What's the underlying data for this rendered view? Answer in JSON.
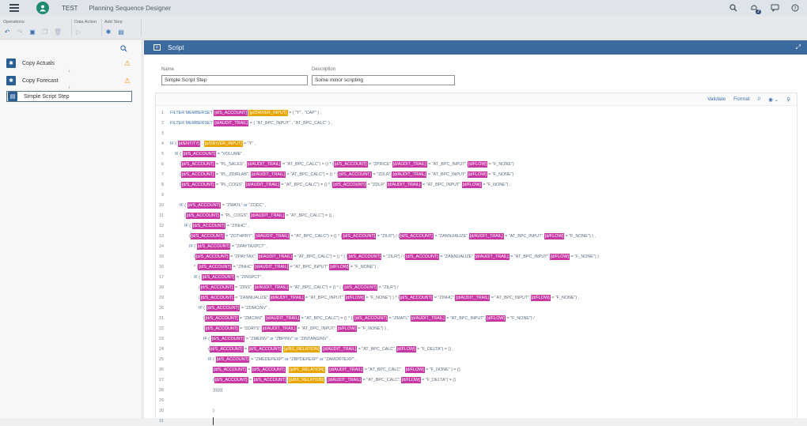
{
  "shell": {
    "app_name": "TEST",
    "title": "Planning Sequence Designer"
  },
  "toolbar": {
    "groups": [
      {
        "label": "Operations"
      },
      {
        "label": "Data Action"
      },
      {
        "label": "Add Step"
      }
    ]
  },
  "steps": [
    {
      "label": "Copy Actuals",
      "warning": true
    },
    {
      "label": "Copy Forecast",
      "warning": true
    },
    {
      "label": "Simple Script Step",
      "warning": false
    }
  ],
  "panel": {
    "title": "Script",
    "name_label": "Name",
    "name_value": "Simple Script Step",
    "desc_label": "Description",
    "desc_value": "Some minor scripting"
  },
  "code_toolbar": {
    "validate": "Validate",
    "format": "Format"
  },
  "code": {
    "line_numbers": [
      "1",
      "2",
      "3",
      "4",
      "5",
      "6",
      "7",
      "8",
      "9",
      "10",
      "11",
      "12",
      "13",
      "14",
      "15",
      "16",
      "17",
      "18",
      "19",
      "20",
      "21",
      "22",
      "23",
      "24",
      "25",
      "26",
      "27",
      "28",
      "29",
      "30",
      "31"
    ],
    "l1": "FILTER MEMBERSET [d/S_ACCOUNT] [p/DRIVER_INPUT] = ( \"Y\" , \"CAP\" ) ,",
    "l2": "FILTER MEMBERSET [d/AUDIT_TRAIL] = ( \"AT_BPC_INPUT\" , \"AT_BPC_CALC\" ) ,",
    "l4": "IF ( [d/ENTITY] . [p/DRIVER_INPUT] = \"Y\" ,",
    "l5": "IF ( [d/S_ACCOUNT] = \"VOLUME\" ,",
    "l6": "([d/S_ACCOUNT] = \"PL_SALES\", [d/AUDIT_TRAIL] = \"AT_BPC_CALC\") = () * ([d/S_ACCOUNT] = \"ZPRICE\",[d/AUDIT_TRAIL] = \"AT_BPC_INPUT\",[d/FLOW] = \"F_NONE\")",
    "l7": "([d/S_ACCOUNT] = \"PL_ZDIRLAB\", [d/AUDIT_TRAIL] = \"AT_BPC_CALC\") = () * ([d/S_ACCOUNT] = \"ZDLR\",[d/AUDIT_TRAIL] = \"AT_BPC_INPUT\",[d/FLOW] = \"F_NONE\")",
    "l8": "([d/S_ACCOUNT] = \"PL_COGS\", [d/AUDIT_TRAIL] = \"AT_BPC_CALC\") = () * ([d/S_ACCOUNT] = \"ZDLR\",[d/AUDIT_TRAIL] = \"AT_BPC_INPUT\",[d/FLOW] = \"F_NONE\") ,",
    "l10": "IF ( [d/S_ACCOUNT] = \"ZMATL\" or \"ZODC\" ,",
    "l11": "([d/S_ACCOUNT] = \"PL_COGS\", [d/AUDIT_TRAIL] = \"AT_BPC_CALC\") = () ,",
    "l12": "IF ( [d/S_ACCOUNT] = \"ZINHC\" ,",
    "l13": "([d/S_ACCOUNT] = \"ZOTHPRY\", [d/AUDIT_TRAIL] = \"AT_BPC_CALC\") = () * ([d/S_ACCOUNT] = \"ZILR\") / ([d/S_ACCOUNT] = \"ZANNUALIZE\",[d/AUDIT_TRAIL] = \"AT_BPC_INPUT\",[d/FLOW] = \"F_NONE\") ) ,",
    "l14": "IF ( [d/S_ACCOUNT] = \"ZPAYTAXPCT\" ,",
    "l15": "([d/S_ACCOUNT] = \"ZPAYTAX\", [d/AUDIT_TRAIL] = \"AT_BPC_CALC\") = () * ( ([d/S_ACCOUNT] = \"ZILR\") / ([d/S_ACCOUNT] = \"ZANNUALIZE\",[d/AUDIT_TRAIL] = \"AT_BPC_INPUT\",[d/FLOW] = \"F_NONE\") )",
    "l16": "* ([d/S_ACCOUNT] = \"ZINHC\",[d/AUDIT_TRAIL] = \"AT_BPC_INPUT\",[d/FLOW] = \"F_NONE\") ,",
    "l17": "IF ( [d/S_ACCOUNT] = \"ZINSPCT\" ,",
    "l18": "([d/S_ACCOUNT] = \"ZINS\", [d/AUDIT_TRAIL] = \"AT_BPC_CALC\") = () * ( ([d/S_ACCOUNT] = \"ZILR\") /",
    "l19": "([d/S_ACCOUNT] = \"ZANNUALIZE\",[d/AUDIT_TRAIL] = \"AT_BPC_INPUT\",[d/FLOW] = \"F_NONE\") ) * ([d/S_ACCOUNT] = \"ZINHC\",[d/AUDIT_TRAIL] = \"AT_BPC_INPUT\",[d/FLOW] = \"F_NONE\") ,",
    "l20": "IF ( [d/S_ACCOUNT] = \"ZDMCINV\" ,",
    "l21": "([d/S_ACCOUNT] = \"ZMCINV\", [d/AUDIT_TRAIL] = \"AT_BPC_CALC\") = () * (([d/S_ACCOUNT] = \"ZMATL\",[d/AUDIT_TRAIL] = \"AT_BPC_INPUT\",[d/FLOW] = \"F_NONE\") /",
    "l22": "([d/S_ACCOUNT] = \"ZDAYS\",[d/AUDIT_TRAIL] = \"AT_BPC_INPUT\",[d/FLOW] = \"F_NONE\") ) ,",
    "l23": "IF ( [d/S_ACCOUNT] = \"ZMEINV\" or \"ZBPINV\" or \"ZINTANGINV\" ,",
    "l24": "([d/S_ACCOUNT] = [d/S_ACCOUNT].[p/BS_RELATION], [d/AUDIT_TRAIL] = \"AT_BPC_CALC\",[d/FLOW] = \"F_DELTA\") = () ,",
    "l25": "IF ( [d/S_ACCOUNT] = \"ZMEDEPEXP\" or \"ZBPDEPEXP\" or \"ZAMORTEXP\" ,",
    "l26": "[d/S_ACCOUNT] = [d/S_ACCOUNT] . [p/PL_RELATION] , [d/AUDIT_TRAIL] = \"AT_BPC_CALC\" , [d/FLOW] = \"F_NONE\" ) = ()",
    "l27": "([d/S_ACCOUNT] = [d/S_ACCOUNT].[p/BS_RELATION], [d/AUDIT_TRAIL] = \"AT_BPC_CALC\",[d/FLOW] = \"F_DELTA\") = ()",
    "l28": ")))))))",
    "l30": ")"
  },
  "colors": {
    "panel_header": "#3d6a9e",
    "dimension_chip": "#c738a4",
    "property_chip": "#e8a400",
    "warning": "#e78c07"
  }
}
